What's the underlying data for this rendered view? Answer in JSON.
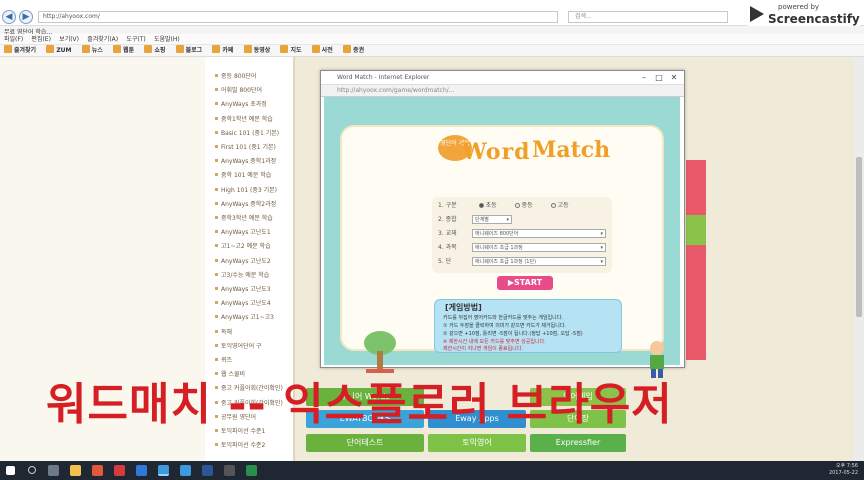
{
  "browser": {
    "url": "http://ahyoox.com/",
    "search_placeholder": "검색...",
    "tab_label": "무료 영단어 학습...",
    "menu": [
      "파일(F)",
      "편집(E)",
      "보기(V)",
      "즐겨찾기(A)",
      "도구(T)",
      "도움말(H)"
    ],
    "favorites": [
      "즐겨찾기",
      "ZUM",
      "뉴스",
      "웹툰",
      "쇼핑",
      "블로그",
      "카페",
      "동영상",
      "지도",
      "사전",
      "증권"
    ],
    "zoom_label": "zoom"
  },
  "screencastify": {
    "small": "powered by",
    "brand": "Screencastify"
  },
  "sidebar": {
    "items": [
      "중등 800단어",
      "어휘빌 800단어",
      "AnyWays 초과정",
      "중학1학년 예문 학습",
      "Basic 101 (중1 기본)",
      "First 101 (중1 기본)",
      "AnyWays 중학1과정",
      "중학 101 예문 학습",
      "High 101 (중3 기본)",
      "AnyWays 중학2과정",
      "중학3학년 예문 학습",
      "AnyWays 고난도1",
      "고1~고2 예문 학습",
      "AnyWays 고난도2",
      "고3/수능 예문 학습",
      "AnyWays 고난도3",
      "AnyWays 고난도4",
      "AnyWays 고1~고3",
      "독해",
      "토익영어단어 구",
      "퀴즈",
      "웹 스쿨비",
      "중고 커플이회(간이확인)",
      "중고 커플이회(간이확인)",
      "공무원 영단어",
      "토익파이선 수준1",
      "토익파이선 수준2"
    ]
  },
  "popup": {
    "title": "Word Match - Internet Explorer",
    "address": "http://ahyoox.com/game/wordmatch/...",
    "badge": "영단어\n게임",
    "title_word": "Word",
    "title_match": "Match",
    "form": {
      "rows": [
        {
          "num": "1.",
          "label": "구분",
          "type": "radio",
          "options": [
            "초등",
            "중등",
            "고등"
          ]
        },
        {
          "num": "2.",
          "label": "종합",
          "type": "select",
          "value": "단계별"
        },
        {
          "num": "3.",
          "label": "교재",
          "type": "select",
          "value": "애니웨이즈 800단어"
        },
        {
          "num": "4.",
          "label": "과목",
          "type": "select",
          "value": "애니웨이즈 초급 1과정"
        },
        {
          "num": "5.",
          "label": "단",
          "type": "select",
          "value": "애니웨이즈 초급 1과정 (1단)"
        }
      ]
    },
    "start_label": "▶START",
    "howto_title": "[게임방법]",
    "howto_lines": [
      "카드를 뒤집어 영어카드와 한글카드를 맞추는 게임입니다.",
      "① 카드 두장을 클릭하여 의미가 같으면 카드가 제거됩니다.",
      "② 같으면 +10점, 틀리면 -5점이 됩니다.(정답 +10점, 오답 -5점)"
    ],
    "howto_red": [
      "※ 제한시간 내에 모든 카드를 맞추면 성공입니다.",
      "   제한시간이 지나면 게임이 종료됩니다."
    ]
  },
  "page_buttons": [
    "주니어 Words",
    "EWAYBOOKS",
    "Eway Apps",
    "단어장",
    "단어테스트",
    "토익영어",
    "영어게임",
    "Expressfier"
  ],
  "caption": "워드매치 -- 익스플로러 브라우저",
  "taskbar": {
    "time": "오후 7:56",
    "date": "2017-05-22"
  },
  "colors": {
    "caption": "#d51f24",
    "accent": "#f0a028",
    "start": "#e84a8a"
  }
}
